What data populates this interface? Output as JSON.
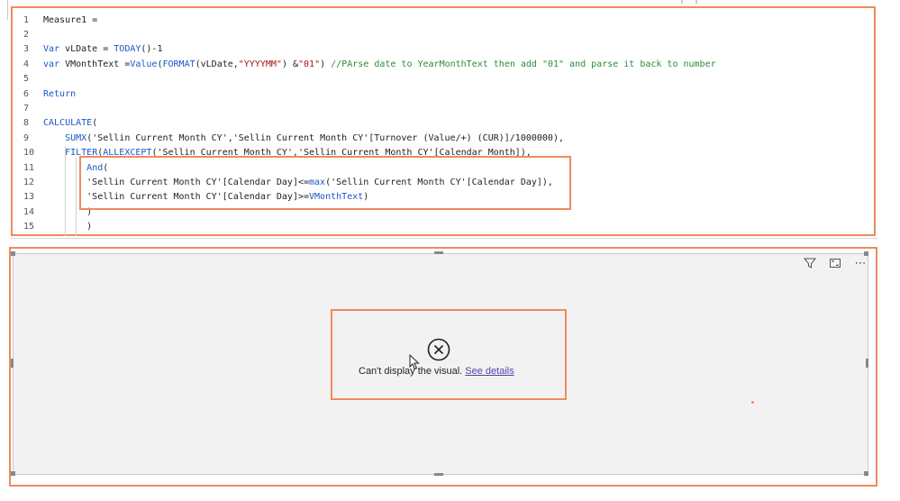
{
  "editor": {
    "lines": [
      {
        "n": "1",
        "html": "Measure1 ="
      },
      {
        "n": "2",
        "html": ""
      },
      {
        "n": "3",
        "html": "<span class='kw'>Var</span> vLDate = <span class='fn'>TODAY</span>()-1"
      },
      {
        "n": "4",
        "html": "<span class='kw'>var</span> VMonthText =<span class='fn'>Value</span>(<span class='fn'>FORMAT</span>(vLDate,<span class='str'>\"YYYYMM\"</span>) &amp;<span class='str'>\"01\"</span>) <span class='cmt'>//PArse date to YearMonthText then add \"01\" and parse it back to number</span>"
      },
      {
        "n": "5",
        "html": ""
      },
      {
        "n": "6",
        "html": "<span class='kw'>Return</span>"
      },
      {
        "n": "7",
        "html": ""
      },
      {
        "n": "8",
        "html": "<span class='fn'>CALCULATE</span>("
      },
      {
        "n": "9",
        "html": "    <span class='fn'>SUMX</span>('Sellin Current Month CY','Sellin Current Month CY'[Turnover (Value/+) (CUR)]/1000000),"
      },
      {
        "n": "10",
        "html": "    <span class='fn'>FILTER</span>(<span class='fn'>ALLEXCEPT</span>('Sellin Current Month CY','Sellin Current Month CY'[Calendar Month]),"
      },
      {
        "n": "11",
        "html": "        <span class='kw'>And</span>("
      },
      {
        "n": "12",
        "html": "        'Sellin Current Month CY'[Calendar Day]&lt;=<span class='fn'>max</span>('Sellin Current Month CY'[Calendar Day]),"
      },
      {
        "n": "13",
        "html": "        'Sellin Current Month CY'[Calendar Day]&gt;=<span class='fn'>VMonthText</span>)"
      },
      {
        "n": "14",
        "html": "        )"
      },
      {
        "n": "15",
        "html": "        )"
      }
    ]
  },
  "visual": {
    "toolbar": {
      "filter_icon": "filter-icon",
      "focus_icon": "focus-mode-icon",
      "more_label": "⋯"
    },
    "error": {
      "icon": "error-circle-icon",
      "message": "Can't display the visual.",
      "link": "See details"
    }
  },
  "colors": {
    "annotation": "#f08a5d",
    "keyword": "#1a57c7",
    "string": "#a31515",
    "comment": "#2f8a3a",
    "link": "#5a3fa8"
  }
}
